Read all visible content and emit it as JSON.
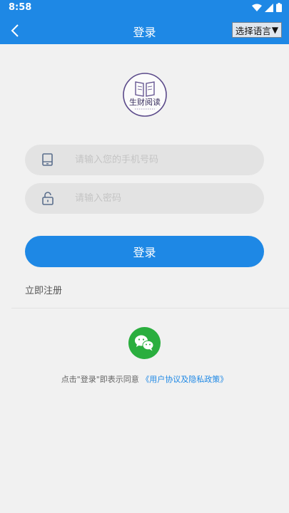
{
  "status_bar": {
    "time": "8:58",
    "icons": [
      "wifi-icon",
      "signal-icon",
      "battery-icon"
    ]
  },
  "app_bar": {
    "title": "登录",
    "back_icon": "chevron-left-icon",
    "language_button": "选择语言",
    "language_arrow": "▼"
  },
  "logo": {
    "text": "生财阅读",
    "icon": "book-icon"
  },
  "form": {
    "phone_placeholder": "请输入您的手机号码",
    "phone_value": "",
    "phone_icon": "phone-icon",
    "password_placeholder": "请输入密码",
    "password_value": "",
    "password_icon": "lock-icon",
    "login_label": "登录",
    "register_label": "立即注册"
  },
  "social": {
    "wechat_icon": "wechat-icon"
  },
  "agreement": {
    "prefix": "点击\"登录\"即表示同意",
    "link": "《用户协议及隐私政策》"
  },
  "colors": {
    "primary": "#1e88e5",
    "background": "#f1f1f1",
    "input_bg": "#e3e3e3",
    "wechat": "#2aae3e"
  }
}
